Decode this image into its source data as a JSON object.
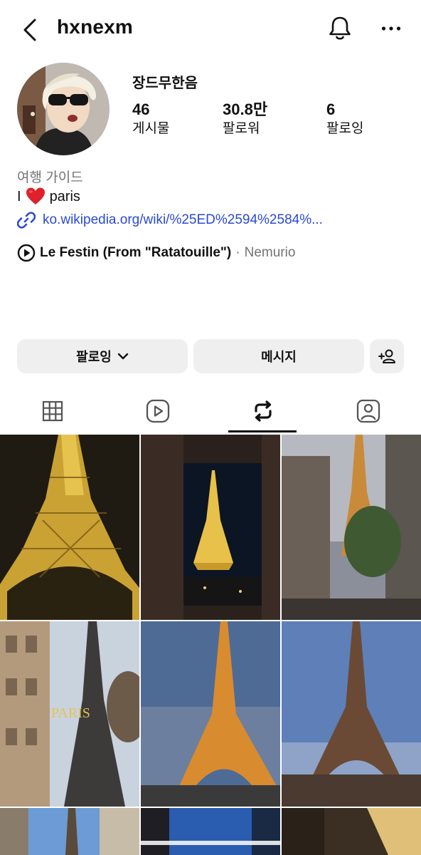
{
  "header": {
    "username": "hxnexm",
    "icons": {
      "back": "chevron-left-icon",
      "notifications": "bell-icon",
      "more": "more-horizontal-icon"
    }
  },
  "profile": {
    "display_name": "장드무한음",
    "stats": {
      "posts": {
        "value": "46",
        "label": "게시물"
      },
      "followers": {
        "value": "30.8만",
        "label": "팔로워"
      },
      "following": {
        "value": "6",
        "label": "팔로잉"
      }
    },
    "category": "여행 가이드",
    "bio": {
      "prefix": "I",
      "emoji_icon": "red-heart-icon",
      "suffix": "paris"
    },
    "link": "ko.wikipedia.org/wiki/%25ED%2594%2584%...",
    "music": {
      "title": "Le Festin (From \"Ratatouille\")",
      "separator": "·",
      "artist": "Nemurio"
    }
  },
  "actions": {
    "follow_label": "팔로잉",
    "message_label": "메시지",
    "add_user_icon": "add-person-icon"
  },
  "tabs": [
    {
      "name": "grid",
      "icon": "grid-icon",
      "active": false
    },
    {
      "name": "reels",
      "icon": "reels-icon",
      "active": false
    },
    {
      "name": "reposts",
      "icon": "repost-icon",
      "active": true
    },
    {
      "name": "tagged",
      "icon": "tagged-person-icon",
      "active": false
    }
  ],
  "grid": {
    "overlay_text": "PARIS",
    "colors": {
      "link": "#2a4ad4",
      "heart": "#e0202a",
      "muted": "#737373",
      "button_bg": "#efefef"
    }
  }
}
